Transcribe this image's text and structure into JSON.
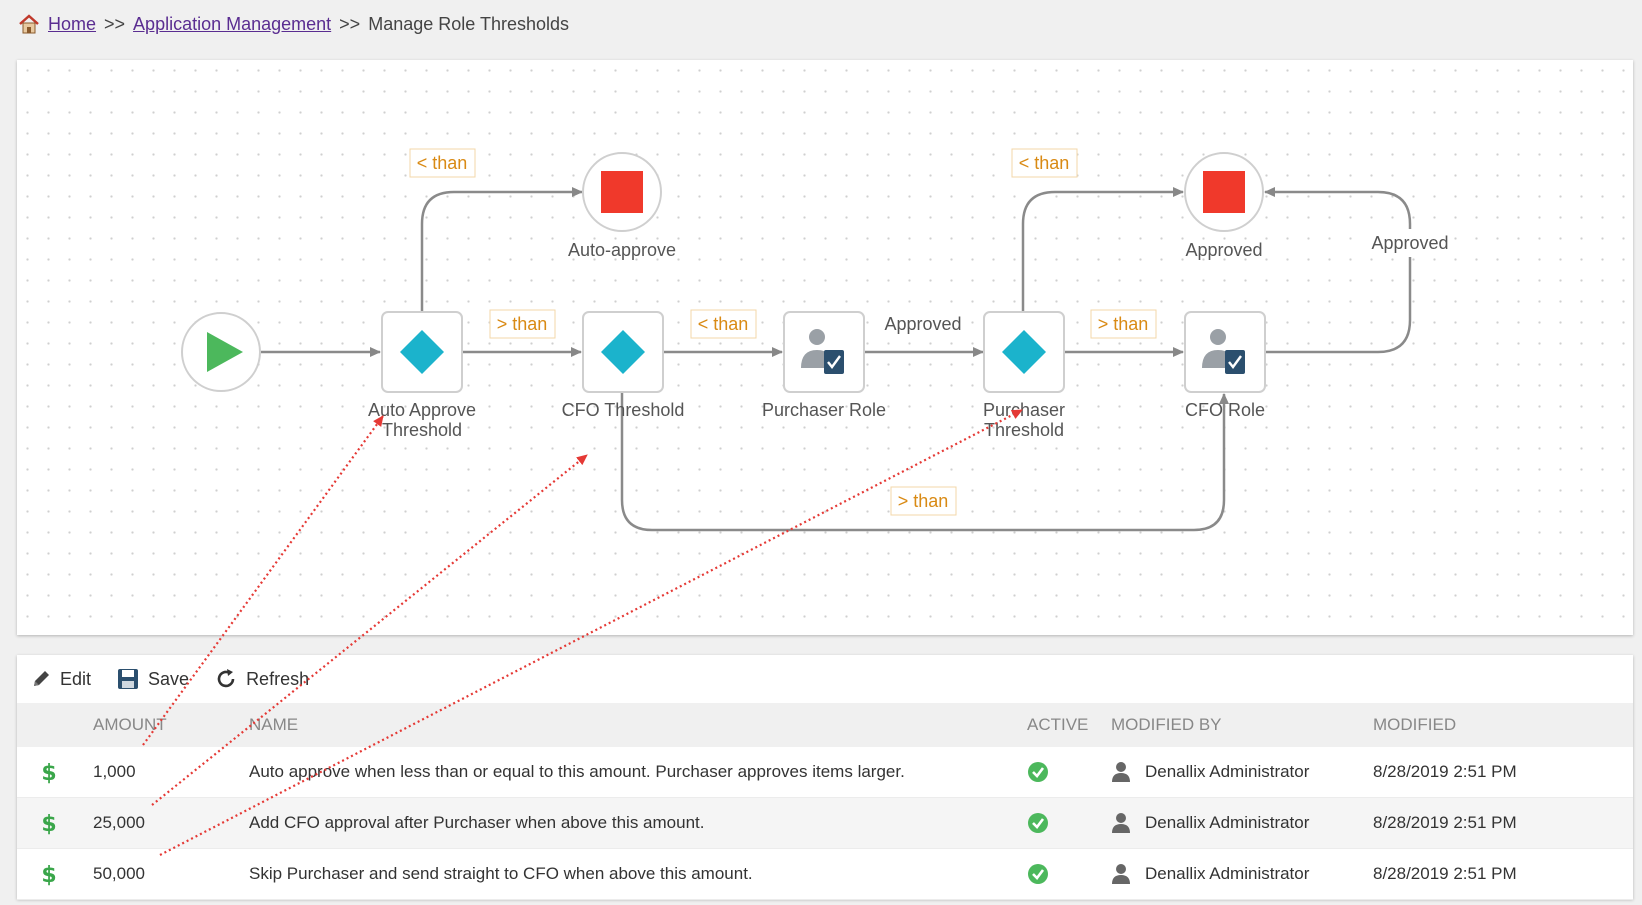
{
  "breadcrumb": {
    "home": "Home",
    "sep1": ">>",
    "app_mgmt": "Application Management",
    "sep2": ">>",
    "current": "Manage Role Thresholds"
  },
  "workflow": {
    "nodes": {
      "auto_approve_end": "Auto-approve",
      "approved_end": "Approved",
      "auto_threshold_l1": "Auto Approve",
      "auto_threshold_l2": "Threshold",
      "cfo_threshold": "CFO Threshold",
      "purchaser_role": "Purchaser Role",
      "purchaser_threshold_l1": "Purchaser",
      "purchaser_threshold_l2": "Threshold",
      "cfo_role": "CFO Role"
    },
    "edges": {
      "lt1": "< than",
      "gt1": "> than",
      "lt2": "< than",
      "approved1": "Approved",
      "lt3": "< than",
      "gt2": "> than",
      "approved2": "Approved",
      "gt_bottom": "> than"
    },
    "colors": {
      "start": "#4cb85c",
      "end": "#f0392b",
      "decision": "#1bb3cc",
      "condition": "#d98a14",
      "annotation": "#e53935"
    }
  },
  "toolbar": {
    "edit": "Edit",
    "save": "Save",
    "refresh": "Refresh"
  },
  "table": {
    "columns": {
      "amount": "AMOUNT",
      "name": "NAME",
      "active": "ACTIVE",
      "modified_by": "MODIFIED BY",
      "modified": "MODIFIED"
    },
    "rows": [
      {
        "icon": "dollar-icon",
        "amount": "1,000",
        "name": "Auto approve when less than or equal to this amount.  Purchaser approves items larger.",
        "active": true,
        "modified_by": "Denallix Administrator",
        "modified": "8/28/2019 2:51 PM"
      },
      {
        "icon": "dollar-icon",
        "amount": "25,000",
        "name": "Add CFO approval after Purchaser when above this amount.",
        "active": true,
        "modified_by": "Denallix Administrator",
        "modified": "8/28/2019 2:51 PM"
      },
      {
        "icon": "dollar-icon",
        "amount": "50,000",
        "name": "Skip Purchaser and send straight to CFO when above this amount.",
        "active": true,
        "modified_by": "Denallix Administrator",
        "modified": "8/28/2019 2:51 PM"
      }
    ]
  }
}
